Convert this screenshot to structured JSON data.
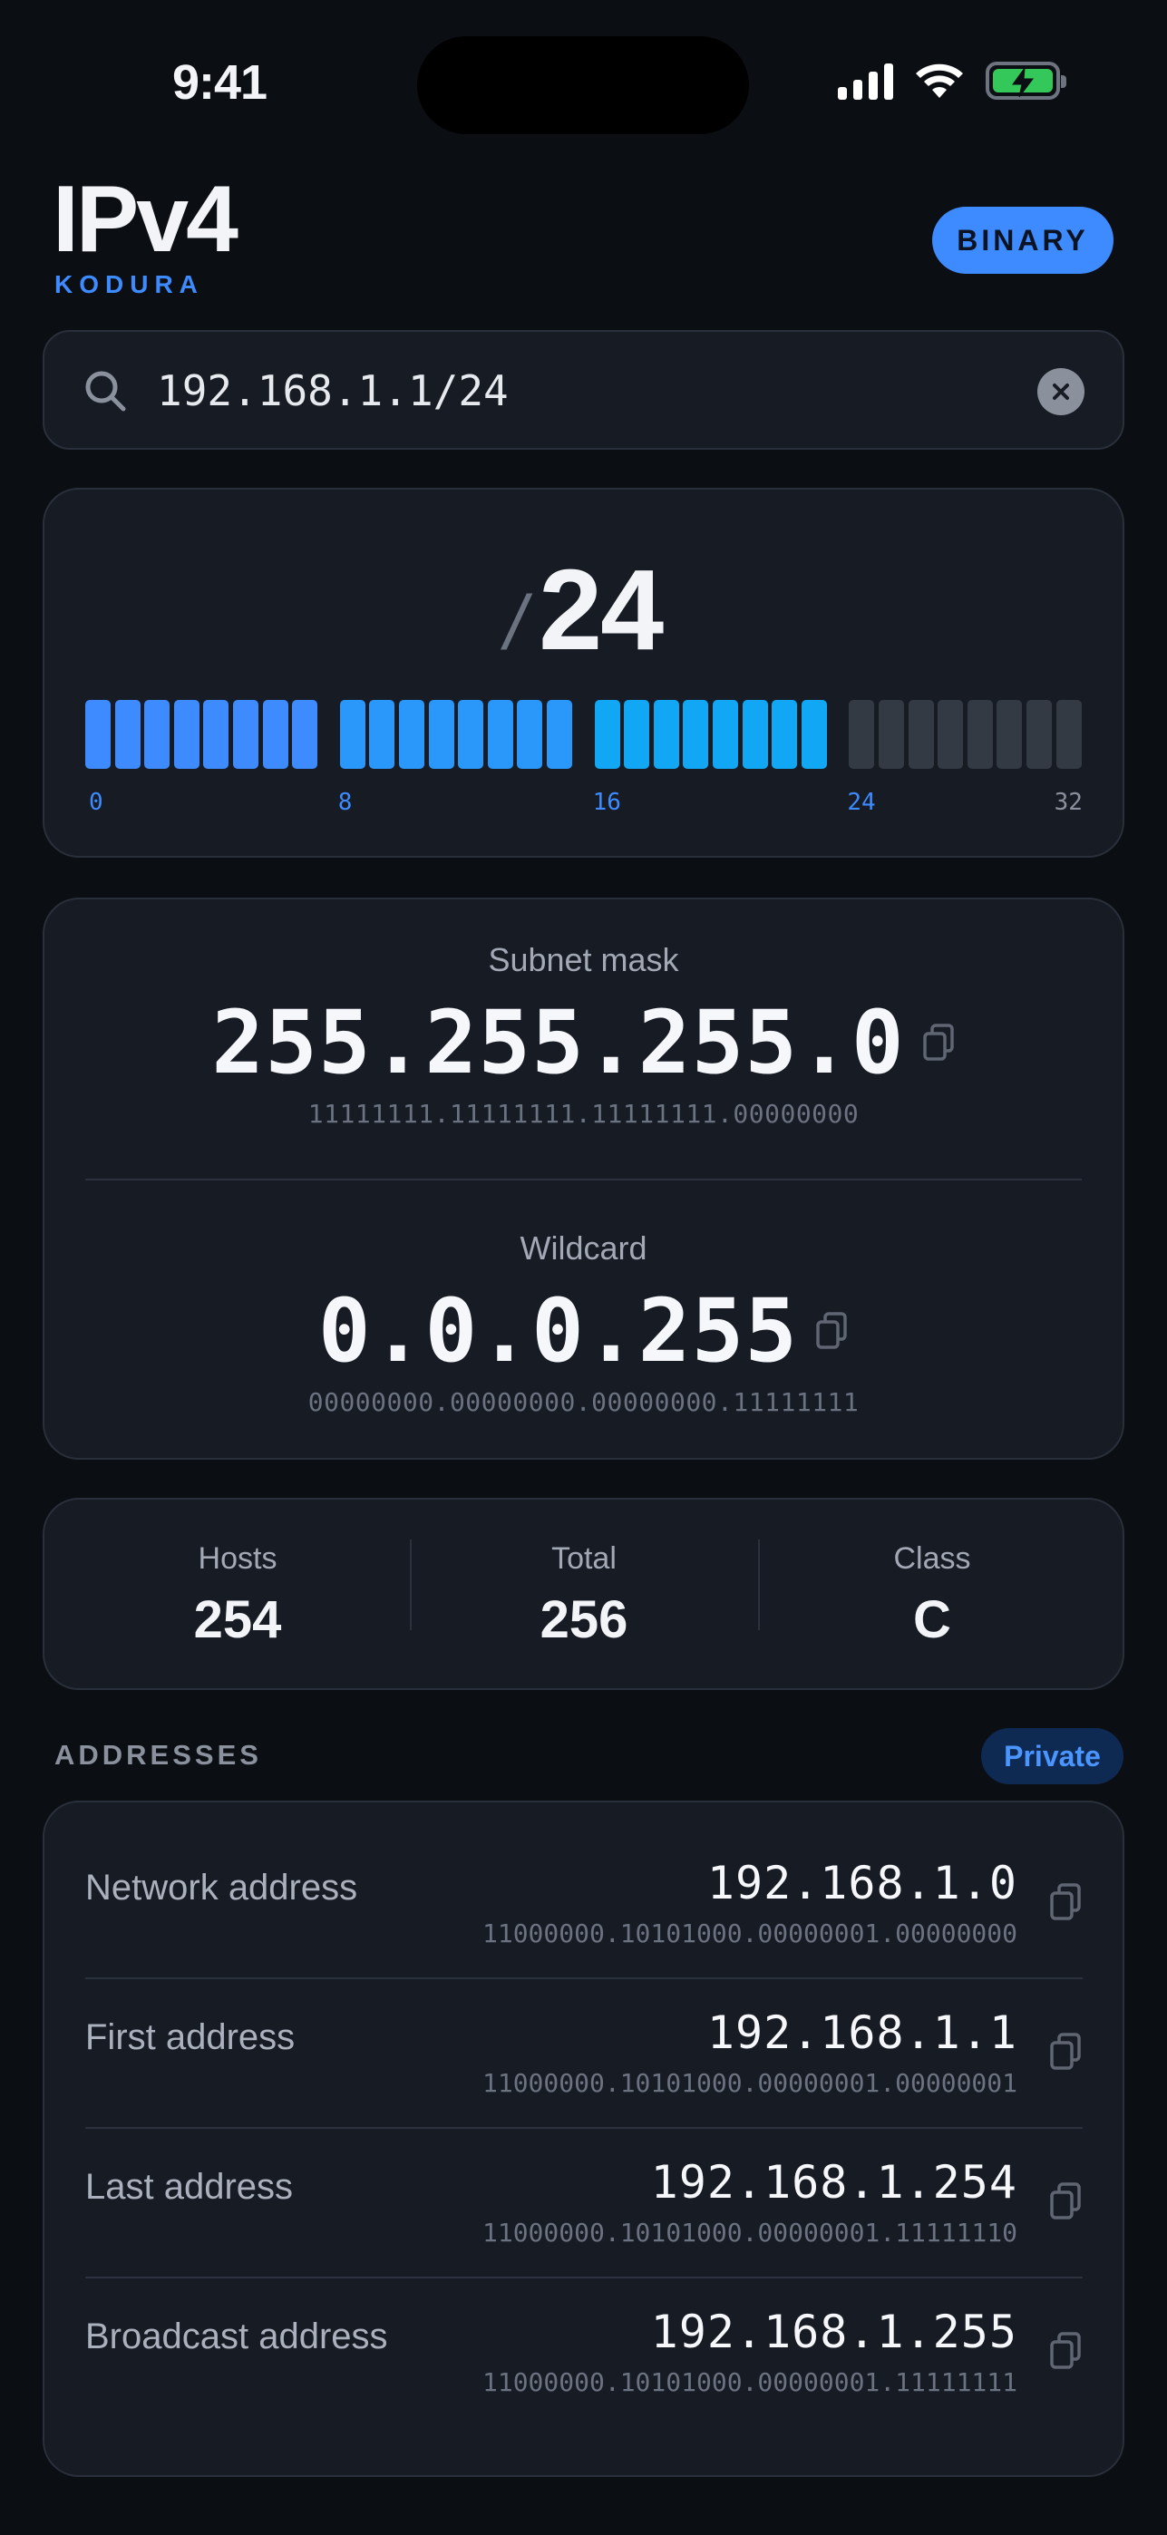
{
  "status_bar": {
    "time": "9:41"
  },
  "header": {
    "title": "IPv4",
    "subtitle": "KODURA",
    "binary_button": "BINARY"
  },
  "search": {
    "value": "192.168.1.1/24"
  },
  "prefix": {
    "slash": "/",
    "length": "24",
    "bit_count": 32,
    "set_bits": 24,
    "tick_labels": [
      "0",
      "8",
      "16",
      "24",
      "32"
    ],
    "colors": {
      "octet1": "#3d8bff",
      "octet2": "#2a97fb",
      "octet3": "#12a7f5",
      "unset": "#343a44"
    }
  },
  "masks": {
    "subnet": {
      "label": "Subnet mask",
      "value": "255.255.255.0",
      "binary": "11111111.11111111.11111111.00000000"
    },
    "wildcard": {
      "label": "Wildcard",
      "value": "0.0.0.255",
      "binary": "00000000.00000000.00000000.11111111"
    }
  },
  "stats": [
    {
      "label": "Hosts",
      "value": "254"
    },
    {
      "label": "Total",
      "value": "256"
    },
    {
      "label": "Class",
      "value": "C"
    }
  ],
  "addresses": {
    "section_label": "ADDRESSES",
    "badge": "Private",
    "rows": [
      {
        "label": "Network address",
        "value": "192.168.1.0",
        "binary": "11000000.10101000.00000001.00000000"
      },
      {
        "label": "First address",
        "value": "192.168.1.1",
        "binary": "11000000.10101000.00000001.00000001"
      },
      {
        "label": "Last address",
        "value": "192.168.1.254",
        "binary": "11000000.10101000.00000001.11111110"
      },
      {
        "label": "Broadcast address",
        "value": "192.168.1.255",
        "binary": "11000000.10101000.00000001.11111111"
      }
    ]
  }
}
